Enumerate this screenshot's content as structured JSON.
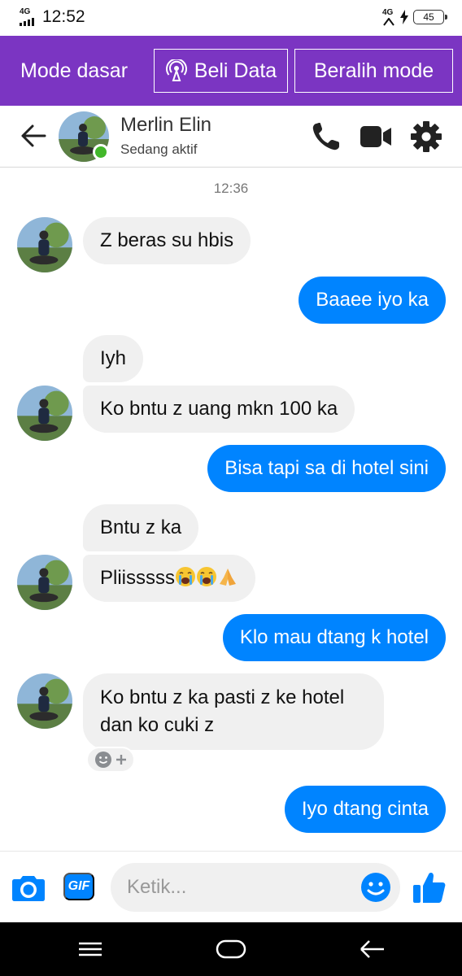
{
  "status_bar": {
    "network": "4G",
    "time": "12:52",
    "network_right": "4G",
    "battery": "45"
  },
  "mode_bar": {
    "label": "Mode dasar",
    "buy_data": "Beli Data",
    "switch_mode": "Beralih mode",
    "color": "#7b35c2"
  },
  "header": {
    "name": "Merlin Elin",
    "status": "Sedang aktif",
    "online_color": "#42b72a"
  },
  "chat": {
    "timestamp": "12:36",
    "messages": [
      {
        "from": "them",
        "text": "Z beras su hbis"
      },
      {
        "from": "me",
        "text": "Baaee iyo ka"
      },
      {
        "from": "them",
        "text": "Iyh"
      },
      {
        "from": "them",
        "text": "Ko bntu z uang mkn 100 ka"
      },
      {
        "from": "me",
        "text": "Bisa tapi sa di hotel sini"
      },
      {
        "from": "them",
        "text": "Bntu z ka"
      },
      {
        "from": "them",
        "text": "Pliisssss",
        "emojis": [
          "crying-face",
          "crying-face",
          "folded-hands"
        ]
      },
      {
        "from": "me",
        "text": "Klo mau dtang k hotel"
      },
      {
        "from": "them",
        "text": "Ko bntu z ka pasti z ke hotel dan ko cuki z"
      },
      {
        "from": "me",
        "text": "Iyo dtang cinta"
      }
    ],
    "outgoing_color": "#0084ff",
    "incoming_color": "#f0f0f0"
  },
  "composer": {
    "placeholder": "Ketik...",
    "gif_label": "GIF"
  }
}
